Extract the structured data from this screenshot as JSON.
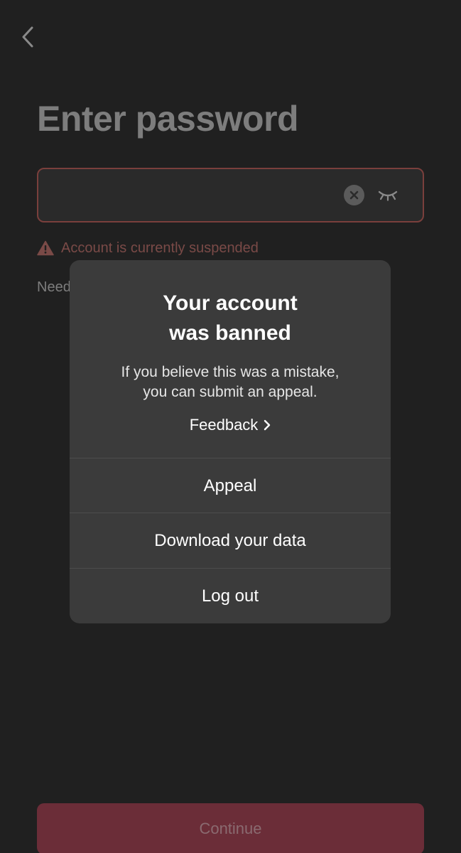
{
  "screen": {
    "title": "Enter password",
    "password_placeholder": "",
    "error_message": "Account is currently suspended",
    "help_link_partial": "Need",
    "continue_label": "Continue"
  },
  "modal": {
    "title_line1": "Your account",
    "title_line2": "was banned",
    "body_line1": "If you believe this was a mistake,",
    "body_line2": "you can submit an appeal.",
    "feedback_label": "Feedback",
    "actions": [
      {
        "label": "Appeal"
      },
      {
        "label": "Download your data"
      },
      {
        "label": "Log out"
      }
    ]
  },
  "icons": {
    "back": "chevron-left-icon",
    "clear": "clear-circle-icon",
    "eye": "eye-closed-icon",
    "warning": "warning-triangle-icon",
    "feedback_chevron": "chevron-right-icon"
  },
  "colors": {
    "background": "#202020",
    "accent": "#6b2d38",
    "error": "#7a4a47",
    "modal_background": "#3b3b3b"
  }
}
